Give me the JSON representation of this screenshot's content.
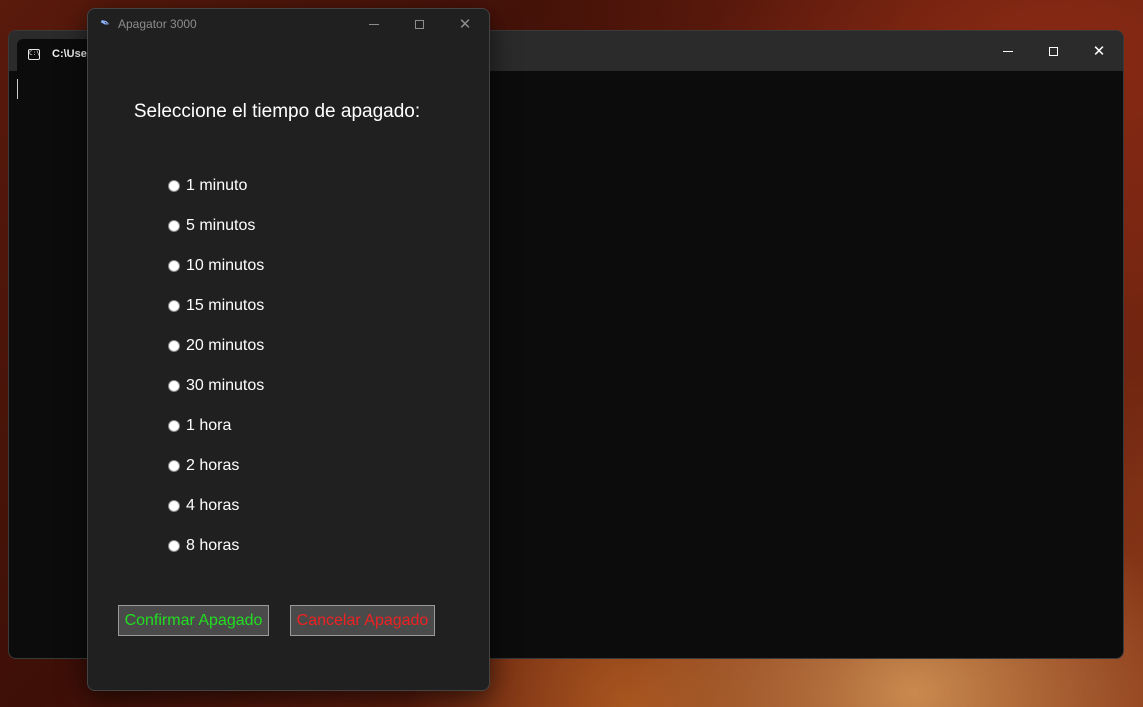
{
  "terminal": {
    "tab_title": "C:\\Use",
    "tab_icon": "cmd-icon",
    "icon_glyph": "C:\\"
  },
  "window": {
    "title": "Apagator 3000",
    "icon": "feather-icon"
  },
  "heading": "Seleccione el tiempo de apagado:",
  "options": [
    "1 minuto",
    "5 minutos",
    "10 minutos",
    "15 minutos",
    "20 minutos",
    "30 minutos",
    "1 hora",
    "2 horas",
    "4 horas",
    "8 horas"
  ],
  "buttons": {
    "confirm": "Confirmar Apagado",
    "cancel": "Cancelar Apagado"
  },
  "colors": {
    "confirm_text": "#22dd22",
    "cancel_text": "#ee2222",
    "window_bg": "#202020",
    "terminal_bg": "#0c0c0c"
  }
}
